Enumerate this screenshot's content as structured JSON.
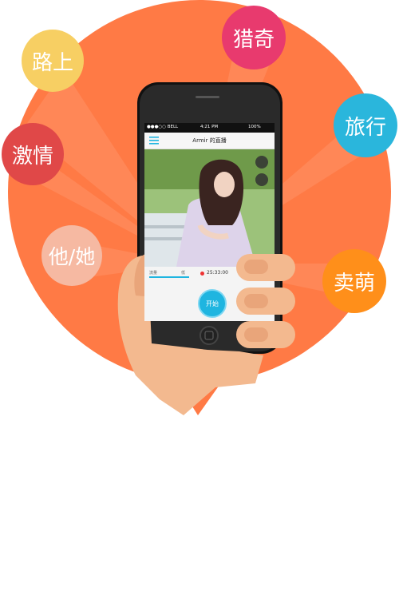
{
  "bubbles": {
    "lushang": "路上",
    "lieqi": "猎奇",
    "lvxing": "旅行",
    "jiqing": "激情",
    "tata": "他/她",
    "maimeng": "卖萌"
  },
  "colors": {
    "orange_disc": "#ff7a45",
    "yellow": "#f7cf63",
    "pink": "#e83a6e",
    "cyan": "#2ab6dc",
    "red": "#e04848",
    "white_translucent": "#f6b9a2",
    "amber": "#ff8f1a",
    "skin": "#f3b98f"
  },
  "phone": {
    "carrier": "●●●○○ BELL",
    "time": "4:21 PM",
    "battery": "100%",
    "title": "Armir 的直播",
    "timer": "25:33:00",
    "left_label": "流量",
    "left_label2": "低",
    "start": "开始"
  }
}
